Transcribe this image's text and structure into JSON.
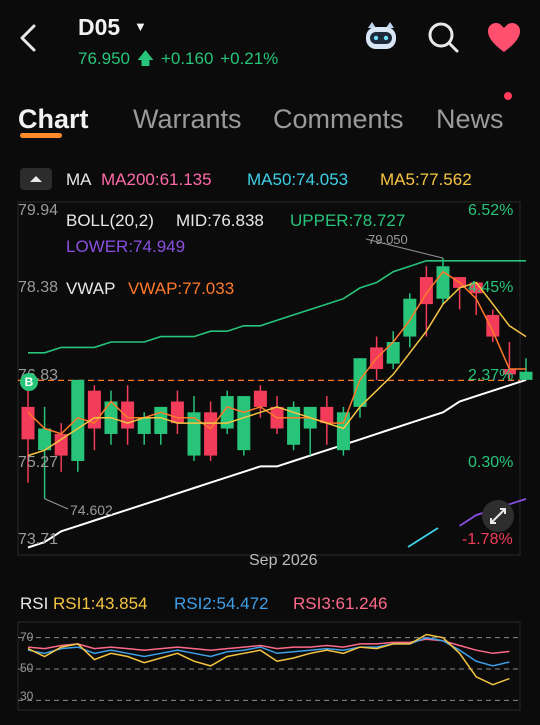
{
  "header": {
    "ticker": "D05",
    "price": "76.950",
    "change": "+0.160",
    "change_pct": "+0.21%",
    "up_color": "#27c47a",
    "down_color": "#f23c5a",
    "icons": [
      "back-icon",
      "robot-icon",
      "search-icon",
      "heart-icon"
    ]
  },
  "tabs": [
    {
      "label": "Chart",
      "active": true
    },
    {
      "label": "Warrants",
      "active": false
    },
    {
      "label": "Comments",
      "active": false
    },
    {
      "label": "News",
      "active": false
    }
  ],
  "indicators": {
    "ma_label": "MA",
    "ma200": "MA200:61.135",
    "ma50": "MA50:74.053",
    "ma5": "MA5:77.562",
    "boll": "BOLL(20,2)",
    "mid": "MID:76.838",
    "upper": "UPPER:78.727",
    "lower": "LOWER:74.949",
    "vwap_label": "VWAP",
    "vwap": "VWAP:77.033"
  },
  "price_axis": [
    "79.94",
    "78.38",
    "76.83",
    "75.27",
    "73.71"
  ],
  "pct_axis": [
    "6.52%",
    "4.45%",
    "2.37%",
    "0.30%",
    "-1.78%"
  ],
  "annotations": {
    "high": "79.050",
    "low": "74.602",
    "buy_marker": "B"
  },
  "x_axis_label": "Sep 2026",
  "chart_data": {
    "type": "candlestick",
    "candles": [
      {
        "o": 76.3,
        "h": 76.7,
        "l": 74.9,
        "c": 75.7,
        "up": false
      },
      {
        "o": 75.5,
        "h": 76.3,
        "l": 74.6,
        "c": 75.9,
        "up": true
      },
      {
        "o": 75.8,
        "h": 76.0,
        "l": 75.1,
        "c": 75.4,
        "up": false
      },
      {
        "o": 75.3,
        "h": 76.8,
        "l": 75.1,
        "c": 76.8,
        "up": true
      },
      {
        "o": 76.6,
        "h": 76.7,
        "l": 75.5,
        "c": 75.9,
        "up": false
      },
      {
        "o": 75.8,
        "h": 76.6,
        "l": 75.6,
        "c": 76.4,
        "up": true
      },
      {
        "o": 76.4,
        "h": 76.7,
        "l": 75.6,
        "c": 75.9,
        "up": false
      },
      {
        "o": 75.8,
        "h": 76.2,
        "l": 75.6,
        "c": 76.1,
        "up": true
      },
      {
        "o": 75.8,
        "h": 76.3,
        "l": 75.6,
        "c": 76.3,
        "up": true
      },
      {
        "o": 76.4,
        "h": 76.6,
        "l": 75.8,
        "c": 76.0,
        "up": false
      },
      {
        "o": 75.4,
        "h": 76.5,
        "l": 75.3,
        "c": 76.2,
        "up": true
      },
      {
        "o": 76.2,
        "h": 76.4,
        "l": 75.3,
        "c": 75.4,
        "up": false
      },
      {
        "o": 75.9,
        "h": 76.6,
        "l": 75.8,
        "c": 76.5,
        "up": true
      },
      {
        "o": 75.5,
        "h": 76.5,
        "l": 75.4,
        "c": 76.5,
        "up": true
      },
      {
        "o": 76.6,
        "h": 76.7,
        "l": 76.1,
        "c": 76.3,
        "up": false
      },
      {
        "o": 76.3,
        "h": 76.5,
        "l": 75.8,
        "c": 75.9,
        "up": false
      },
      {
        "o": 75.6,
        "h": 76.4,
        "l": 75.5,
        "c": 76.3,
        "up": true
      },
      {
        "o": 75.9,
        "h": 76.3,
        "l": 75.4,
        "c": 76.3,
        "up": true
      },
      {
        "o": 76.3,
        "h": 76.5,
        "l": 75.6,
        "c": 76.0,
        "up": false
      },
      {
        "o": 75.5,
        "h": 76.3,
        "l": 75.4,
        "c": 76.2,
        "up": true
      },
      {
        "o": 76.3,
        "h": 77.2,
        "l": 76.1,
        "c": 77.2,
        "up": true
      },
      {
        "o": 77.4,
        "h": 77.6,
        "l": 76.8,
        "c": 77.0,
        "up": false
      },
      {
        "o": 77.1,
        "h": 77.7,
        "l": 77.0,
        "c": 77.5,
        "up": true
      },
      {
        "o": 77.6,
        "h": 78.4,
        "l": 77.4,
        "c": 78.3,
        "up": true
      },
      {
        "o": 78.7,
        "h": 78.9,
        "l": 77.6,
        "c": 78.2,
        "up": false
      },
      {
        "o": 78.3,
        "h": 79.05,
        "l": 78.2,
        "c": 78.9,
        "up": true
      },
      {
        "o": 78.7,
        "h": 78.7,
        "l": 78.1,
        "c": 78.5,
        "up": false
      },
      {
        "o": 78.6,
        "h": 78.6,
        "l": 78.0,
        "c": 78.4,
        "up": false
      },
      {
        "o": 78.0,
        "h": 78.1,
        "l": 77.5,
        "c": 77.6,
        "up": false
      },
      {
        "o": 77.0,
        "h": 77.5,
        "l": 76.8,
        "c": 76.9,
        "up": false
      },
      {
        "o": 76.8,
        "h": 77.2,
        "l": 76.8,
        "c": 76.95,
        "up": true
      }
    ],
    "boll_upper": [
      77.3,
      77.3,
      77.4,
      77.4,
      77.4,
      77.5,
      77.5,
      77.5,
      77.6,
      77.6,
      77.6,
      77.7,
      77.7,
      77.8,
      77.8,
      77.9,
      78.0,
      78.1,
      78.2,
      78.3,
      78.5,
      78.6,
      78.8,
      78.9,
      79.0,
      79.0,
      79.0,
      79.0,
      79.0,
      79.0,
      79.0
    ],
    "boll_lower": [
      null,
      null,
      null,
      null,
      null,
      null,
      null,
      null,
      null,
      null,
      null,
      null,
      null,
      null,
      null,
      null,
      null,
      null,
      null,
      null,
      null,
      null,
      null,
      null,
      null,
      null,
      74.1,
      74.3,
      74.4,
      74.5,
      74.6
    ],
    "ma50": [
      73.7,
      73.8,
      74.0,
      74.1,
      74.2,
      74.3,
      74.4,
      74.5,
      74.6,
      74.7,
      74.8,
      74.9,
      75.0,
      75.1,
      75.2,
      75.2,
      75.3,
      75.4,
      75.5,
      75.6,
      75.7,
      75.8,
      75.9,
      76.0,
      76.1,
      76.2,
      76.4,
      76.5,
      76.6,
      76.7,
      76.8
    ],
    "ma5": [
      75.4,
      75.5,
      75.7,
      75.9,
      76.1,
      76.1,
      76.0,
      76.1,
      76.1,
      76.0,
      76.0,
      76.0,
      76.0,
      76.1,
      76.2,
      76.3,
      76.2,
      76.1,
      76.0,
      75.9,
      76.3,
      76.6,
      76.9,
      77.3,
      77.7,
      78.2,
      78.5,
      78.6,
      78.2,
      77.8,
      77.6
    ],
    "vwap": [
      76.2,
      75.9,
      75.8,
      76.1,
      76.0,
      76.4,
      76.1,
      76.1,
      76.2,
      76.1,
      76.1,
      75.9,
      76.3,
      76.2,
      76.3,
      76.1,
      76.1,
      76.1,
      76.0,
      76.0,
      76.8,
      77.2,
      77.5,
      77.9,
      78.4,
      78.8,
      78.6,
      78.3,
      77.7,
      77.0,
      77.0
    ],
    "ylim": [
      73.71,
      79.94
    ],
    "prev_close": 76.79,
    "rsi": {
      "rsi1": [
        63,
        58,
        64,
        66,
        56,
        60,
        58,
        54,
        57,
        60,
        55,
        52,
        58,
        60,
        62,
        55,
        57,
        60,
        62,
        60,
        64,
        63,
        66,
        66,
        72,
        70,
        60,
        45,
        40,
        43.854
      ],
      "rsi2": [
        62,
        60,
        63,
        64,
        60,
        62,
        60,
        58,
        60,
        62,
        60,
        58,
        61,
        62,
        64,
        60,
        61,
        62,
        63,
        62,
        64,
        64,
        66,
        66,
        70,
        68,
        62,
        55,
        52,
        54.472
      ],
      "rsi3": [
        64,
        63,
        65,
        66,
        63,
        64,
        63,
        62,
        63,
        64,
        63,
        62,
        63,
        64,
        65,
        63,
        64,
        64,
        65,
        64,
        66,
        66,
        67,
        67,
        69,
        68,
        65,
        62,
        60,
        61.246
      ],
      "ylim": [
        20,
        80
      ],
      "levels": [
        70,
        50,
        30
      ]
    }
  },
  "rsi_labels": {
    "title": "RSI",
    "rsi1": "RSI1:43.854",
    "rsi2": "RSI2:54.472",
    "rsi3": "RSI3:61.246",
    "l70": "70",
    "l50": "50",
    "l30": "30"
  }
}
